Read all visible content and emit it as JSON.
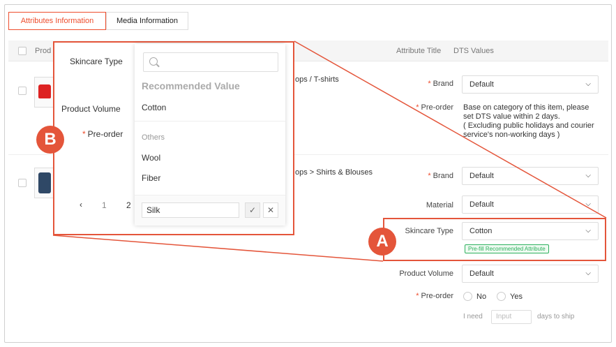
{
  "tabs": [
    {
      "label": "Attributes Information",
      "active": true
    },
    {
      "label": "Media Information",
      "active": false
    }
  ],
  "table_header": {
    "product_col": "Prod",
    "attribute_title": "Attribute Title",
    "dts_values": "DTS Values"
  },
  "rows": [
    {
      "category": "ops / T-shirts",
      "brand_label": "Brand",
      "brand_value": "Default",
      "preorder_label": "Pre-order",
      "preorder_note": [
        "Base on category of this item, please",
        "set DTS value within 2 days.",
        "( Excluding public holidays and courier",
        "service's non-working days )"
      ]
    },
    {
      "category": "ops > Shirts & Blouses",
      "brand_label": "Brand",
      "brand_value": "Default",
      "material_label": "Material",
      "material_value": "Default",
      "skincare_label": "Skincare Type",
      "skincare_value": "Cotton",
      "prefill_badge": "Pre-fill Recommended Attribute",
      "volume_label": "Product Volume",
      "volume_value": "Default",
      "preorder_label": "Pre-order",
      "radio_no": "No",
      "radio_yes": "Yes",
      "need_text": "I need",
      "input_placeholder": "Input",
      "days_text": "days to ship"
    }
  ],
  "callouts": {
    "a": "A",
    "b": "B"
  },
  "zoom": {
    "skincare_label": "Skincare Type",
    "volume_label": "Product Volume",
    "preorder_label": "Pre-order",
    "dropdown": {
      "search_placeholder": "",
      "heading": "Recommended Value",
      "recommended": [
        "Cotton"
      ],
      "others_label": "Others",
      "others": [
        "Wool",
        "Fiber"
      ],
      "custom_value": "Silk"
    },
    "pagination": {
      "prev": "‹",
      "pages": [
        "1",
        "2"
      ]
    }
  },
  "colors": {
    "accent": "#ee4d2d",
    "callout": "#e4553a",
    "green": "#2eb15e"
  }
}
